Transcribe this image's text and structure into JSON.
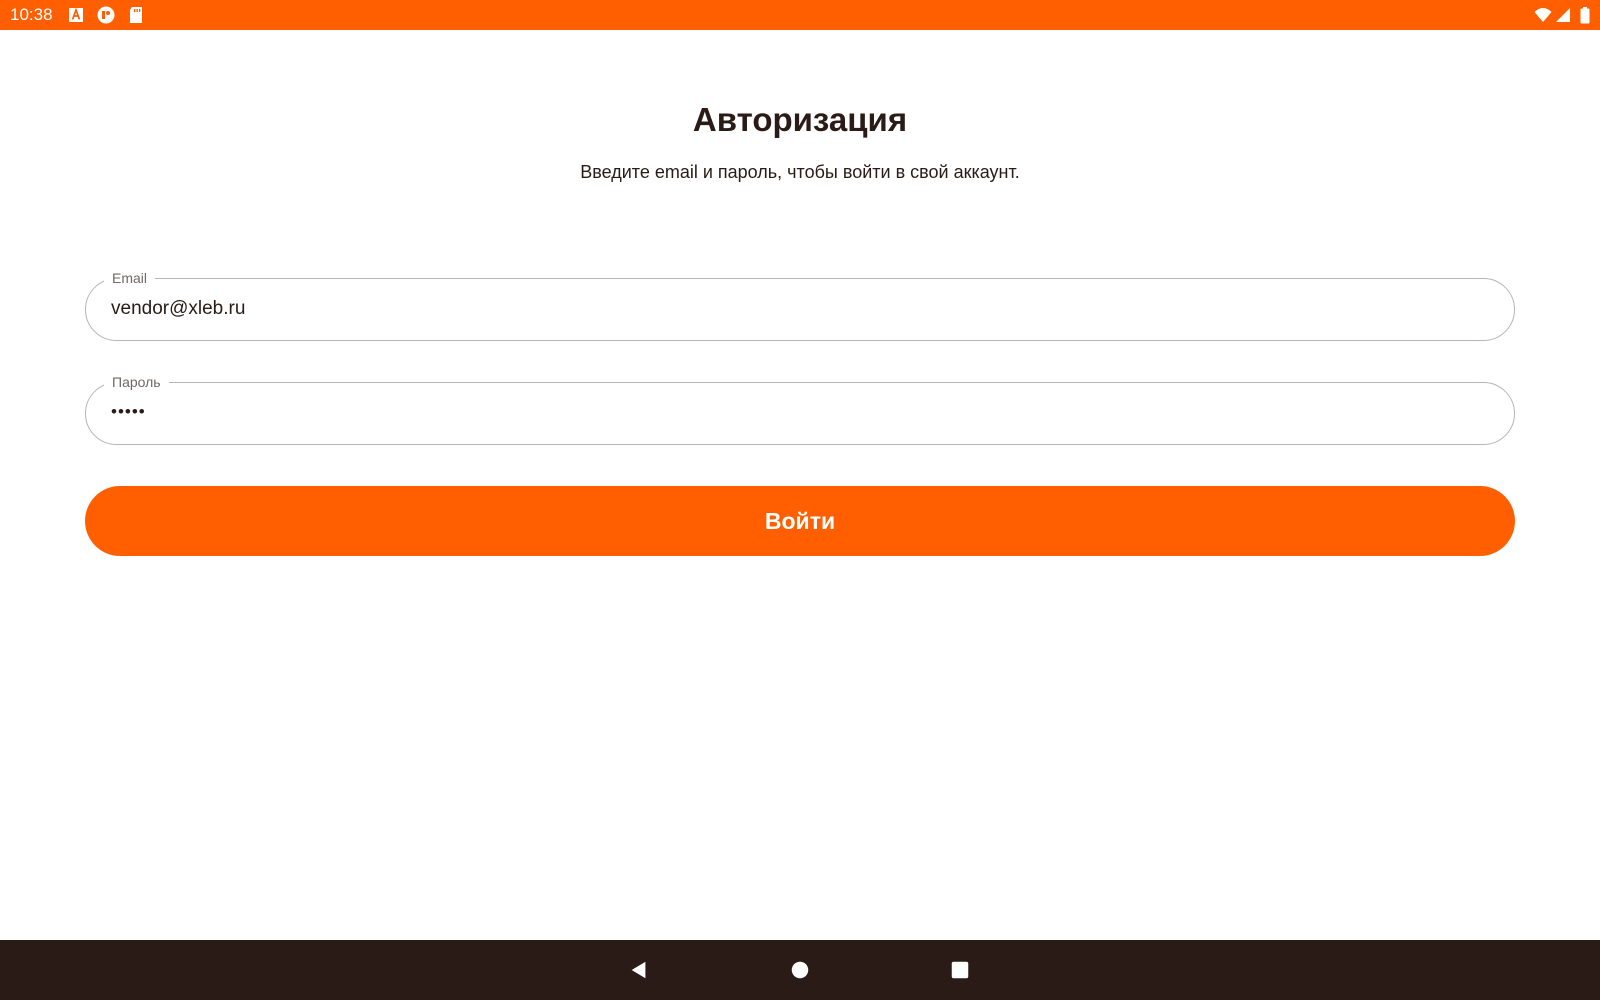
{
  "status_bar": {
    "time": "10:38",
    "background": "#ff5f00",
    "left_icons": [
      "text-a-icon",
      "app-notification-icon",
      "sd-card-icon"
    ],
    "right_icons": [
      "wifi-icon",
      "cell-signal-icon",
      "battery-icon"
    ]
  },
  "auth": {
    "title": "Авторизация",
    "subtitle": "Введите email и пароль, чтобы войти в свой аккаунт."
  },
  "form": {
    "email": {
      "label": "Email",
      "value": "vendor@xleb.ru"
    },
    "password": {
      "label": "Пароль",
      "masked_value": "•••••"
    },
    "submit_label": "Войти",
    "accent_color": "#ff5f00"
  },
  "navigation_bar": {
    "background": "#2a1b16",
    "buttons": [
      "back-icon",
      "home-icon",
      "recents-icon"
    ]
  }
}
